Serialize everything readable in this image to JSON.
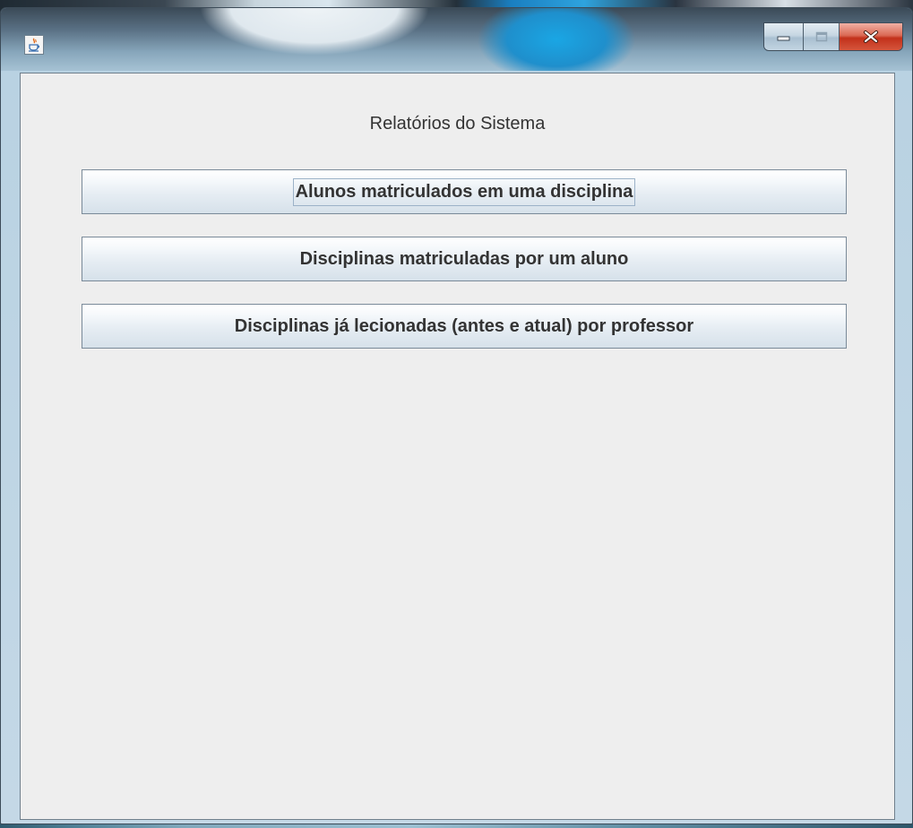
{
  "window": {
    "caption_buttons": {
      "minimize_icon": "minimize-icon",
      "maximize_icon": "maximize-icon",
      "close_icon": "close-icon",
      "close_color": "#c2311b"
    },
    "app_icon": "java-cup-icon"
  },
  "main": {
    "title": "Relatórios do Sistema",
    "buttons": [
      {
        "label": "Alunos matriculados em uma disciplina"
      },
      {
        "label": "Disciplinas matriculadas por um aluno"
      },
      {
        "label": "Disciplinas já lecionadas (antes e atual) por professor"
      }
    ]
  },
  "colors": {
    "client_background": "#eeeeee",
    "text": "#333333"
  }
}
